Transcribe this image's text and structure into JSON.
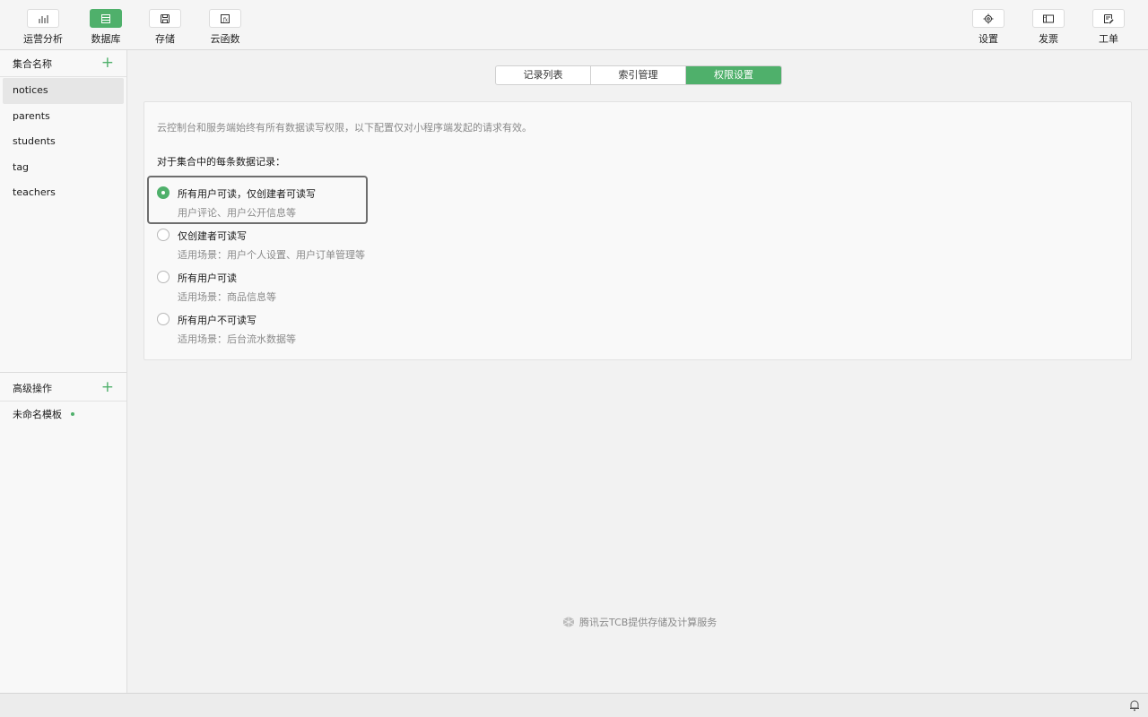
{
  "toolbar": {
    "left_tools": [
      {
        "label": "运营分析",
        "icon": "bar-chart-icon"
      },
      {
        "label": "数据库",
        "icon": "database-icon",
        "active": true
      },
      {
        "label": "存储",
        "icon": "floppy-disk-icon"
      },
      {
        "label": "云函数",
        "icon": "function-icon"
      }
    ],
    "right_tools": [
      {
        "label": "设置",
        "icon": "gear-icon"
      },
      {
        "label": "发票",
        "icon": "invoice-icon"
      },
      {
        "label": "工单",
        "icon": "ticket-icon"
      }
    ]
  },
  "sidebar": {
    "collections_title": "集合名称",
    "collections": [
      "notices",
      "parents",
      "students",
      "tag",
      "teachers"
    ],
    "selected": "notices",
    "advanced_title": "高级操作",
    "templates": [
      "未命名模板"
    ]
  },
  "tabs": [
    {
      "label": "记录列表"
    },
    {
      "label": "索引管理"
    },
    {
      "label": "权限设置",
      "active": true
    }
  ],
  "permissions": {
    "notice": "云控制台和服务端始终有所有数据读写权限，以下配置仅对小程序端发起的请求有效。",
    "for_each": "对于集合中的每条数据记录：",
    "options": [
      {
        "title": "所有用户可读，仅创建者可读写",
        "subtitle": "用户评论、用户公开信息等",
        "checked": true
      },
      {
        "title": "仅创建者可读写",
        "subtitle": "适用场景：用户个人设置、用户订单管理等",
        "checked": false
      },
      {
        "title": "所有用户可读",
        "subtitle": "适用场景：商品信息等",
        "checked": false
      },
      {
        "title": "所有用户不可读写",
        "subtitle": "适用场景：后台流水数据等",
        "checked": false
      }
    ]
  },
  "footer": {
    "text": "腾讯云TCB提供存储及计算服务",
    "icon": "cube-icon"
  },
  "statusbar": {
    "icon": "bell-icon"
  },
  "colors": {
    "accent": "#4fb06b",
    "muted_text": "#8a8a8a"
  }
}
